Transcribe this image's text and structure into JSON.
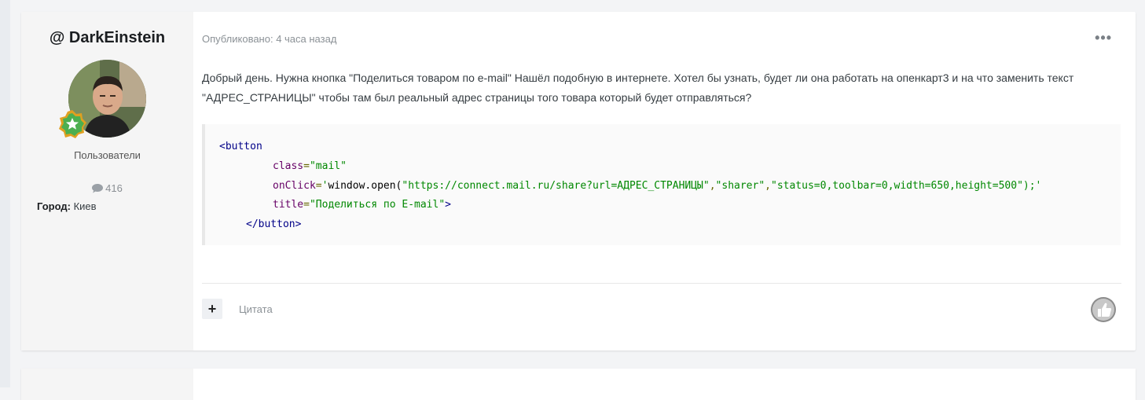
{
  "author": {
    "name": "@ DarkEinstein",
    "group": "Пользователи",
    "post_count": "416",
    "city_label": "Город:",
    "city_value": "Киев"
  },
  "post": {
    "published": "Опубликовано: 4 часа назад",
    "more_label": "•••",
    "text": "Добрый день. Нужна кнопка \"Поделиться товаром по e-mail\" Нашёл подобную в интернете. Хотел бы узнать, будет ли она работать на опенкарт3 и на что заменить текст \"АДРЕС_СТРАНИЦЫ\" чтобы там был реальный адрес страницы того товара который будет отправляться?",
    "code": {
      "l1_tag": "<button",
      "l2_attr": "class",
      "l2_eq": "=",
      "l2_val": "\"mail\"",
      "l3_attr": "onClick",
      "l3_eq": "=",
      "l3_q1": "'",
      "l3_fn": "window.open(",
      "l3_arg1": "\"https://connect.mail.ru/share?url=АДРЕС_СТРАНИЦЫ\"",
      "l3_c1": ",",
      "l3_arg2": "\"sharer\"",
      "l3_c2": ",",
      "l3_arg3": "\"status=0,toolbar=0,width=650,height=500\"",
      "l3_end": ");'",
      "l4_attr": "title",
      "l4_eq": "=",
      "l4_val": "\"Поделиться по E-mail\"",
      "l4_close": ">",
      "l5_tag": "</button>"
    },
    "plus_label": "+",
    "quote_label": "Цитата"
  },
  "colors": {
    "accent_star": "#4caf50",
    "badge_border": "#e0a020",
    "code_string": "#008800",
    "code_tag": "#000088"
  },
  "icons": {
    "chat": "chat-bubble-icon",
    "star": "star-badge-icon",
    "thumb": "thumbs-up-icon"
  }
}
